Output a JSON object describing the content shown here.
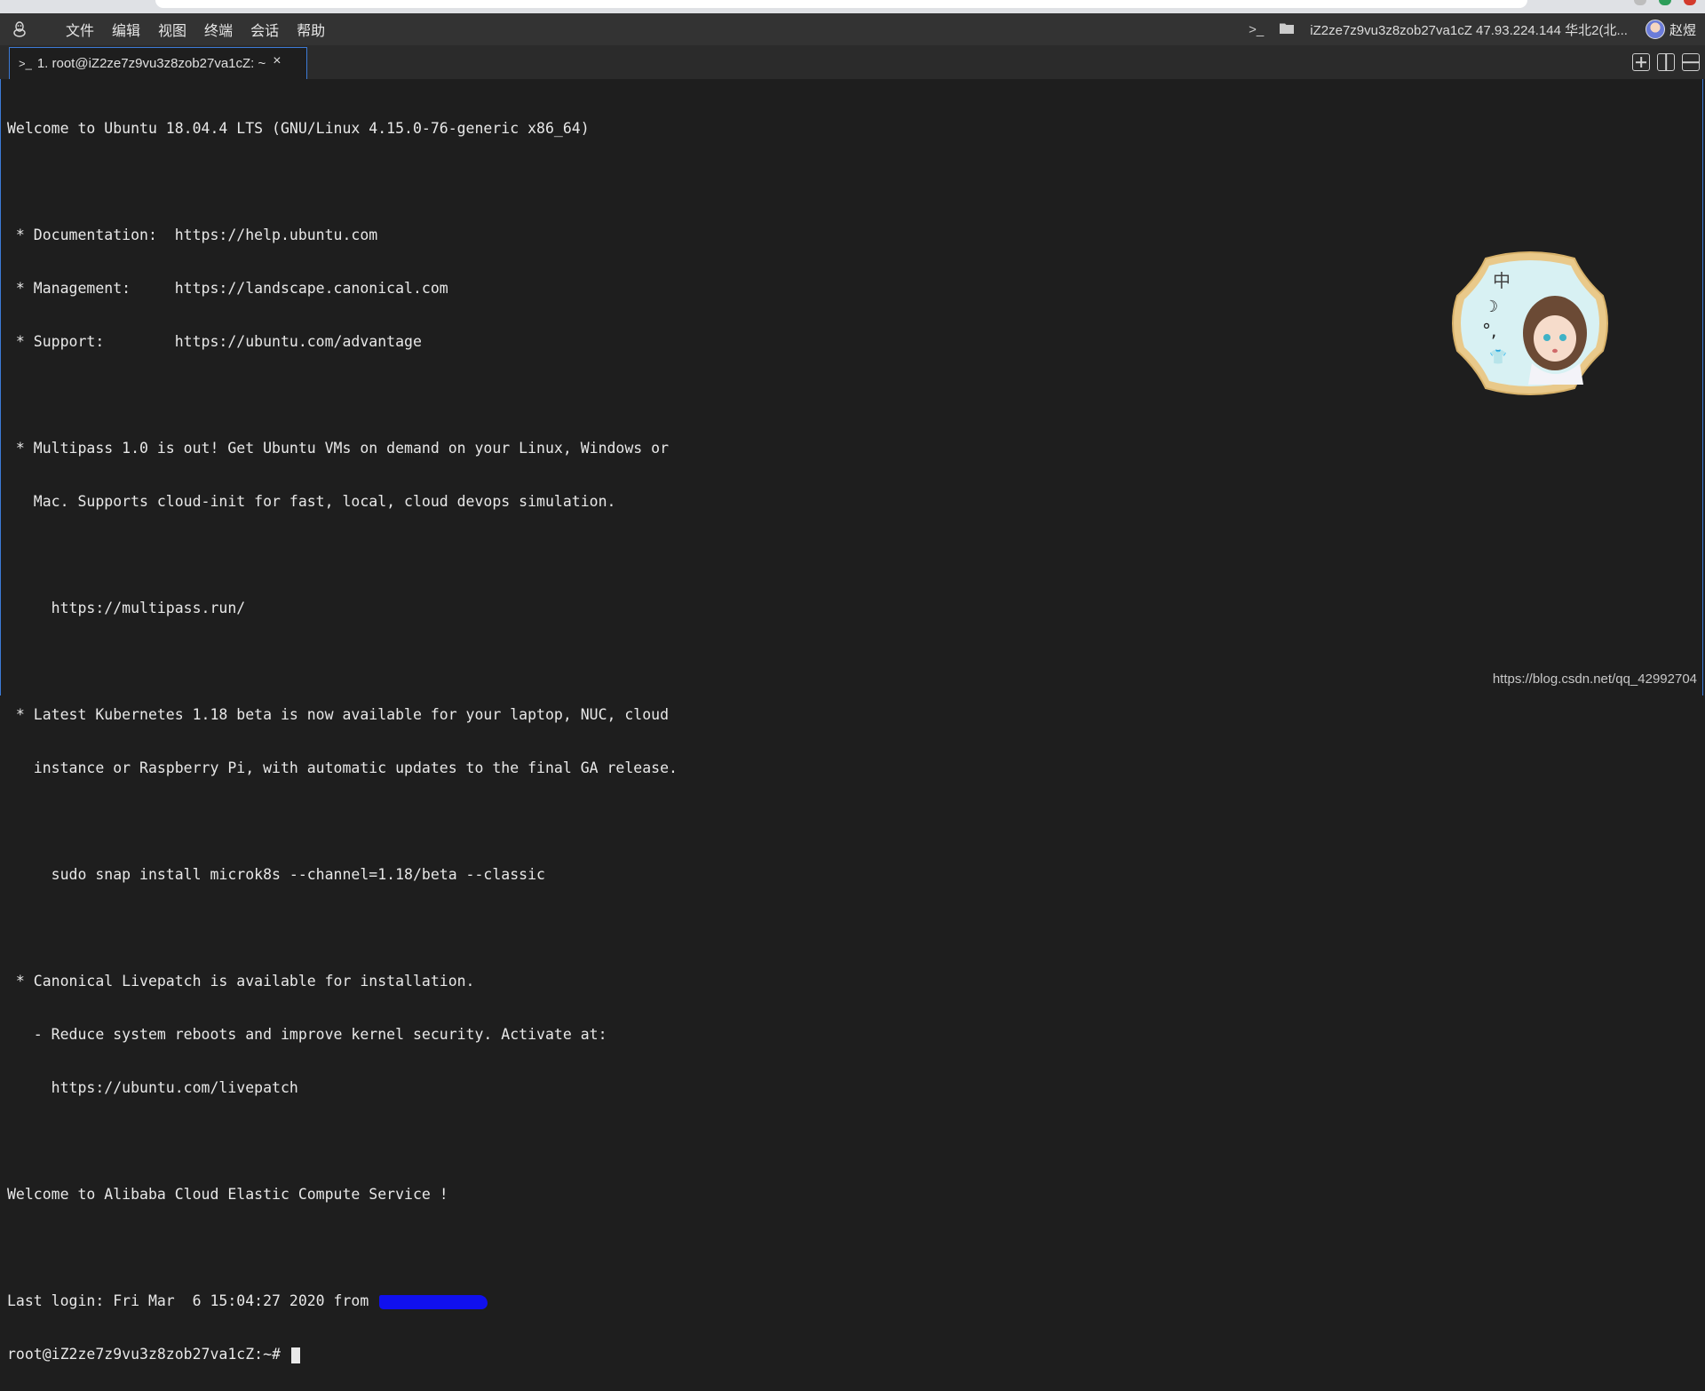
{
  "menubar": {
    "items": [
      "文件",
      "编辑",
      "视图",
      "终端",
      "会话",
      "帮助"
    ],
    "host_label": "iZ2ze7z9vu3z8zob27va1cZ 47.93.224.144 华北2(北...",
    "user": "赵煜",
    "icons": [
      "penguin-icon",
      "terminal-icon",
      "folder-icon",
      "avatar"
    ]
  },
  "tab": {
    "title": "1. root@iZ2ze7z9vu3z8zob27va1cZ: ~",
    "close": "×"
  },
  "terminal": {
    "lines": [
      "Welcome to Ubuntu 18.04.4 LTS (GNU/Linux 4.15.0-76-generic x86_64)",
      "",
      " * Documentation:  https://help.ubuntu.com",
      " * Management:     https://landscape.canonical.com",
      " * Support:        https://ubuntu.com/advantage",
      "",
      " * Multipass 1.0 is out! Get Ubuntu VMs on demand on your Linux, Windows or",
      "   Mac. Supports cloud-init for fast, local, cloud devops simulation.",
      "",
      "     https://multipass.run/",
      "",
      " * Latest Kubernetes 1.18 beta is now available for your laptop, NUC, cloud",
      "   instance or Raspberry Pi, with automatic updates to the final GA release.",
      "",
      "     sudo snap install microk8s --channel=1.18/beta --classic",
      "",
      " * Canonical Livepatch is available for installation.",
      "   - Reduce system reboots and improve kernel security. Activate at:",
      "     https://ubuntu.com/livepatch",
      "",
      "Welcome to Alibaba Cloud Elastic Compute Service !",
      ""
    ],
    "last_login": "Last login: Fri Mar  6 15:04:27 2020 from ",
    "prompt": "root@iZ2ze7z9vu3z8zob27va1cZ:~# "
  },
  "ime_badge": {
    "chars": [
      "中",
      "☽",
      "°,",
      "👕"
    ]
  },
  "watermark": "https://blog.csdn.net/qq_42992704",
  "colors": {
    "menubar_bg": "#333333",
    "terminal_bg": "#1e1e1e",
    "tab_border": "#3c7ad6",
    "redaction": "#1010ee"
  }
}
